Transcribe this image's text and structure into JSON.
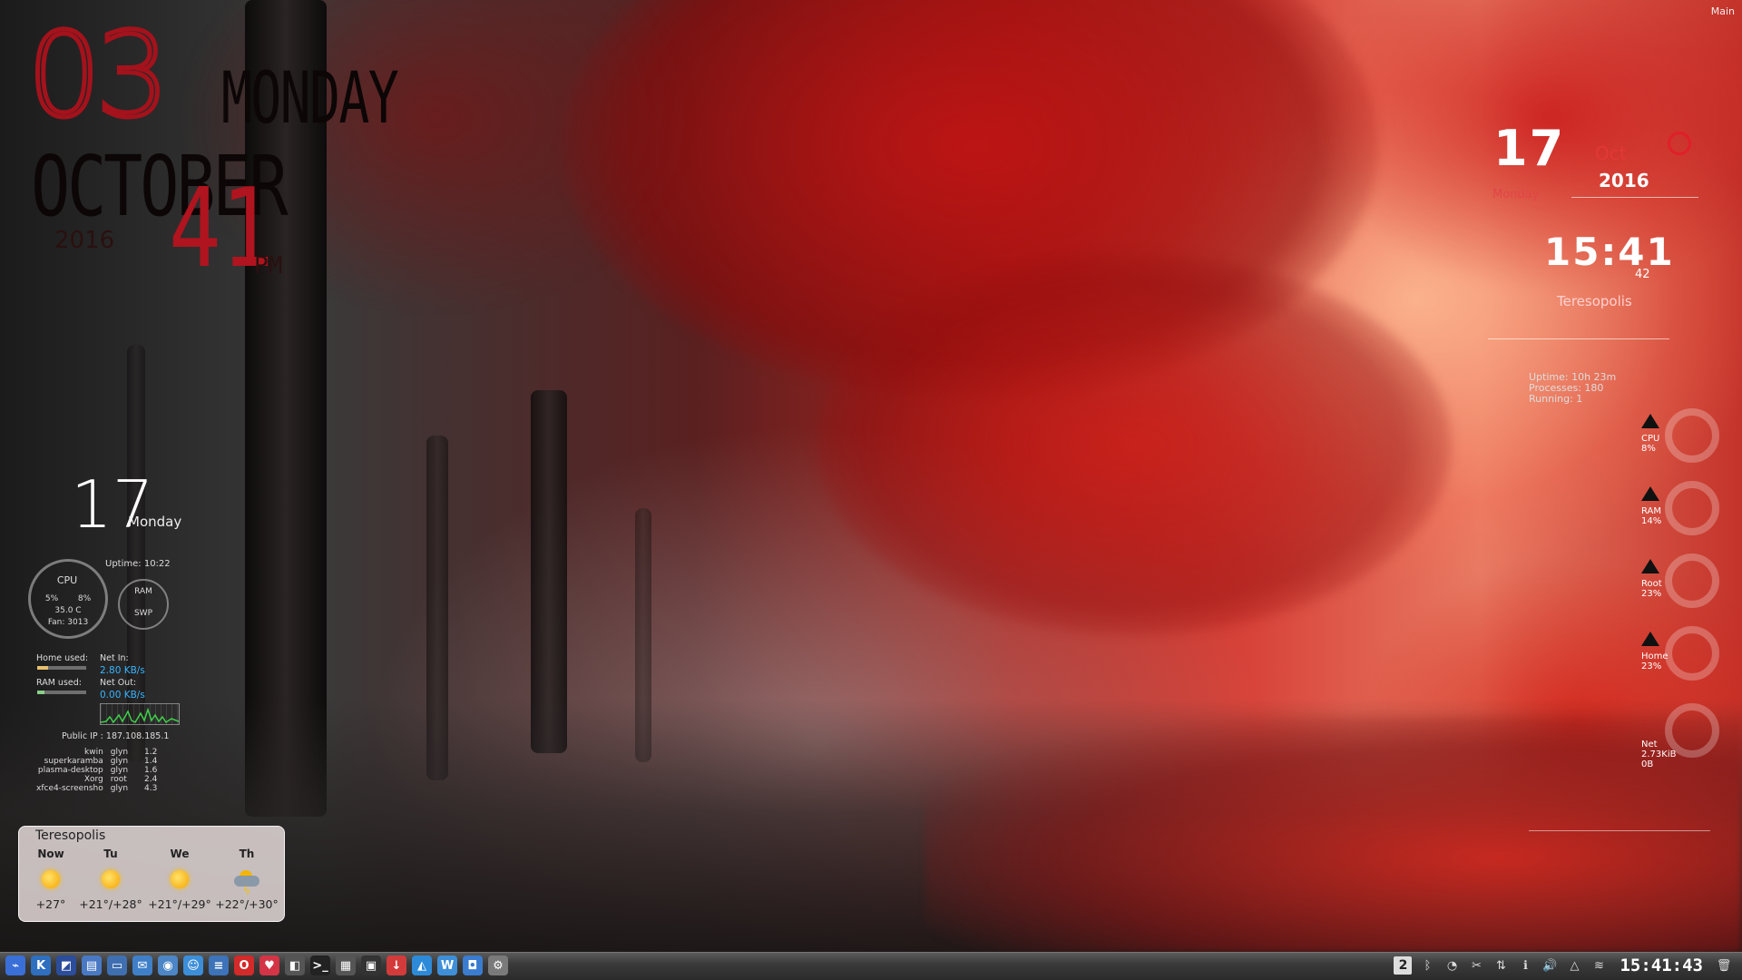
{
  "corner_label": "Main",
  "big_clock": {
    "day": "03",
    "weekday": "MONDAY",
    "month": "OCTOBER",
    "year": "2016",
    "minutes": "41",
    "ampm": "PM"
  },
  "sysmon": {
    "date": "17",
    "weekday": "Monday",
    "uptime_label": "Uptime:",
    "uptime_value": "10:22",
    "cpu_label": "CPU",
    "cpu_core1": "5%",
    "cpu_core2": "8%",
    "cpu_temp": "35.0 C",
    "fan": "Fan: 3013",
    "ram_label": "RAM",
    "swp_label": "SWP",
    "home_used_label": "Home used:",
    "home_used_fraction": 0.23,
    "ram_used_label": "RAM used:",
    "ram_used_fraction": 0.14,
    "net_in_label": "Net In:",
    "net_in_value": "2.80 KB/s",
    "net_out_label": "Net Out:",
    "net_out_value": "0.00 KB/s",
    "public_ip": "Public IP : 187.108.185.1",
    "processes": [
      {
        "name": "kwin",
        "user": "glyn",
        "cpu": "1.2"
      },
      {
        "name": "superkaramba",
        "user": "glyn",
        "cpu": "1.4"
      },
      {
        "name": "plasma-desktop",
        "user": "glyn",
        "cpu": "1.6"
      },
      {
        "name": "Xorg",
        "user": "root",
        "cpu": "2.4"
      },
      {
        "name": "xfce4-screensho",
        "user": "glyn",
        "cpu": "4.3"
      }
    ]
  },
  "weather": {
    "city": "Teresopolis",
    "days": [
      {
        "label": "Now",
        "icon": "sun-icon",
        "temp": "+27°"
      },
      {
        "label": "Tu",
        "icon": "sun-icon",
        "temp": "+21°/+28°"
      },
      {
        "label": "We",
        "icon": "sun-icon",
        "temp": "+21°/+29°"
      },
      {
        "label": "Th",
        "icon": "storm-icon",
        "temp": "+22°/+30°"
      }
    ]
  },
  "right_clock": {
    "day": "17",
    "month": "Oct",
    "year": "2016",
    "weekday": "Monday",
    "time": "15:41",
    "seconds": "42",
    "city": "Teresopolis"
  },
  "right_info": {
    "uptime": "Uptime: 10h 23m",
    "processes": "Processes: 180",
    "running": "Running: 1"
  },
  "right_gauges": [
    {
      "label": "CPU",
      "value": "8%"
    },
    {
      "label": "RAM",
      "value": "14%"
    },
    {
      "label": "Root",
      "value": "23%"
    },
    {
      "label": "Home",
      "value": "23%"
    },
    {
      "label": "Net",
      "value": "2.73KiB",
      "value2": "0B"
    }
  ],
  "taskbar": {
    "launchers": [
      {
        "name": "kickoff-icon",
        "glyph": "⌁",
        "color": "#3a6fd8"
      },
      {
        "name": "kde-icon",
        "glyph": "K",
        "color": "#2f6fc0"
      },
      {
        "name": "security-icon",
        "glyph": "◩",
        "color": "#2b4d9b"
      },
      {
        "name": "file-manager-icon",
        "glyph": "▤",
        "color": "#4a79c4"
      },
      {
        "name": "folder-icon",
        "glyph": "▭",
        "color": "#3f6fb0"
      },
      {
        "name": "mail-icon",
        "glyph": "✉",
        "color": "#3f7fc8"
      },
      {
        "name": "browser-icon",
        "glyph": "◉",
        "color": "#4c86c6"
      },
      {
        "name": "finder-icon",
        "glyph": "☺",
        "color": "#3c8ed8"
      },
      {
        "name": "notes-icon",
        "glyph": "≡",
        "color": "#3d73b8"
      },
      {
        "name": "opera-icon",
        "glyph": "O",
        "color": "#d32a2a"
      },
      {
        "name": "pocket-icon",
        "glyph": "♥",
        "color": "#d33446"
      },
      {
        "name": "puzzle-icon",
        "glyph": "◧",
        "color": "#555555"
      },
      {
        "name": "terminal-icon",
        "glyph": ">_",
        "color": "#222222"
      },
      {
        "name": "apps-icon",
        "glyph": "▦",
        "color": "#555555"
      },
      {
        "name": "monitor-icon",
        "glyph": "▣",
        "color": "#333333"
      },
      {
        "name": "download-icon",
        "glyph": "↓",
        "color": "#d33b3b"
      },
      {
        "name": "image-icon",
        "glyph": "◭",
        "color": "#2d8ad8"
      },
      {
        "name": "writer-icon",
        "glyph": "W",
        "color": "#3f8fd8"
      },
      {
        "name": "screenshot-icon",
        "glyph": "◘",
        "color": "#3a7cd0"
      },
      {
        "name": "settings-icon",
        "glyph": "⚙",
        "color": "#7a7a7a"
      }
    ],
    "desktop_number": "2",
    "tray": [
      {
        "name": "bluetooth-icon",
        "glyph": "ᛒ"
      },
      {
        "name": "clipboard-icon",
        "glyph": "◔"
      },
      {
        "name": "scissors-icon",
        "glyph": "✂"
      },
      {
        "name": "network-icon",
        "glyph": "⇅"
      },
      {
        "name": "notification-icon",
        "glyph": "ℹ"
      },
      {
        "name": "volume-icon",
        "glyph": "🔊"
      },
      {
        "name": "expand-tray-icon",
        "glyph": "△"
      },
      {
        "name": "wifi-icon",
        "glyph": "≋"
      }
    ],
    "clock": "15:41:43",
    "trash_icon": "trash-icon"
  }
}
